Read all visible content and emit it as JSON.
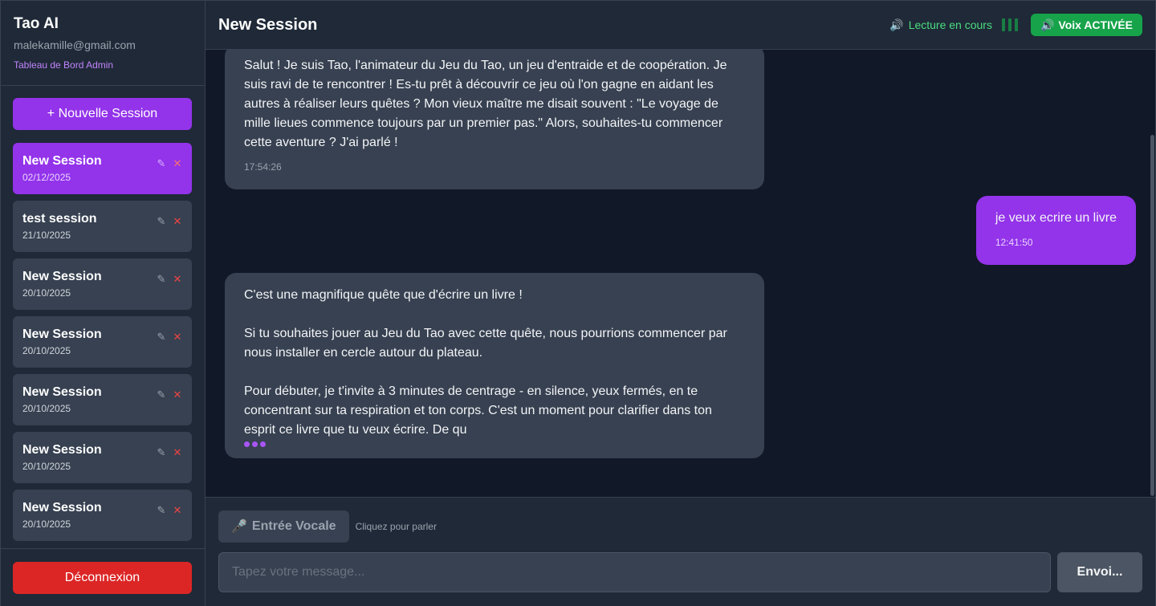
{
  "sidebar": {
    "app_title": "Tao AI",
    "user_email": "malekamille@gmail.com",
    "admin_link": "Tableau de Bord Admin",
    "new_session_label": "+ Nouvelle Session",
    "sessions": [
      {
        "title": "New Session",
        "date": "02/12/2025",
        "active": true
      },
      {
        "title": "test session",
        "date": "21/10/2025",
        "active": false
      },
      {
        "title": "New Session",
        "date": "20/10/2025",
        "active": false
      },
      {
        "title": "New Session",
        "date": "20/10/2025",
        "active": false
      },
      {
        "title": "New Session",
        "date": "20/10/2025",
        "active": false
      },
      {
        "title": "New Session",
        "date": "20/10/2025",
        "active": false
      },
      {
        "title": "New Session",
        "date": "20/10/2025",
        "active": false
      }
    ],
    "edit_icon": "✎",
    "delete_icon": "✕",
    "logout_label": "Déconnexion"
  },
  "header": {
    "title": "New Session",
    "reading_status": "Lecture en cours",
    "voice_button": "Voix ACTIVÉE",
    "speaker_icon": "🔊"
  },
  "messages": [
    {
      "role": "assistant",
      "text": "Salut ! Je suis Tao, l'animateur du Jeu du Tao, un jeu d'entraide et de coopération. Je suis ravi de te rencontrer ! Es-tu prêt à découvrir ce jeu où l'on gagne en aidant les autres à réaliser leurs quêtes ? Mon vieux maître me disait souvent : \"Le voyage de mille lieues commence toujours par un premier pas.\" Alors, souhaites-tu commencer cette aventure ? J'ai parlé !",
      "time": "17:54:26"
    },
    {
      "role": "user",
      "text": "je veux ecrire un livre",
      "time": "12:41:50"
    },
    {
      "role": "assistant",
      "text": "C'est une magnifique quête que d'écrire un livre !\n\nSi tu souhaites jouer au Jeu du Tao avec cette quête, nous pourrions commencer par nous installer en cercle autour du plateau.\n\nPour débuter, je t'invite à 3 minutes de centrage - en silence, yeux fermés, en te concentrant sur ta respiration et ton corps. C'est un moment pour clarifier dans ton esprit ce livre que tu veux écrire. De qu",
      "time": "",
      "streaming": true
    }
  ],
  "composer": {
    "voice_input_label": "Entrée Vocale",
    "voice_hint": "Cliquez pour parler",
    "mic_icon": "🎤",
    "input_placeholder": "Tapez votre message...",
    "input_value": "",
    "send_label": "Envoi..."
  },
  "colors": {
    "accent": "#9333ea",
    "danger": "#dc2626",
    "success": "#16a34a",
    "bg": "#111827",
    "panel": "#1f2937"
  }
}
